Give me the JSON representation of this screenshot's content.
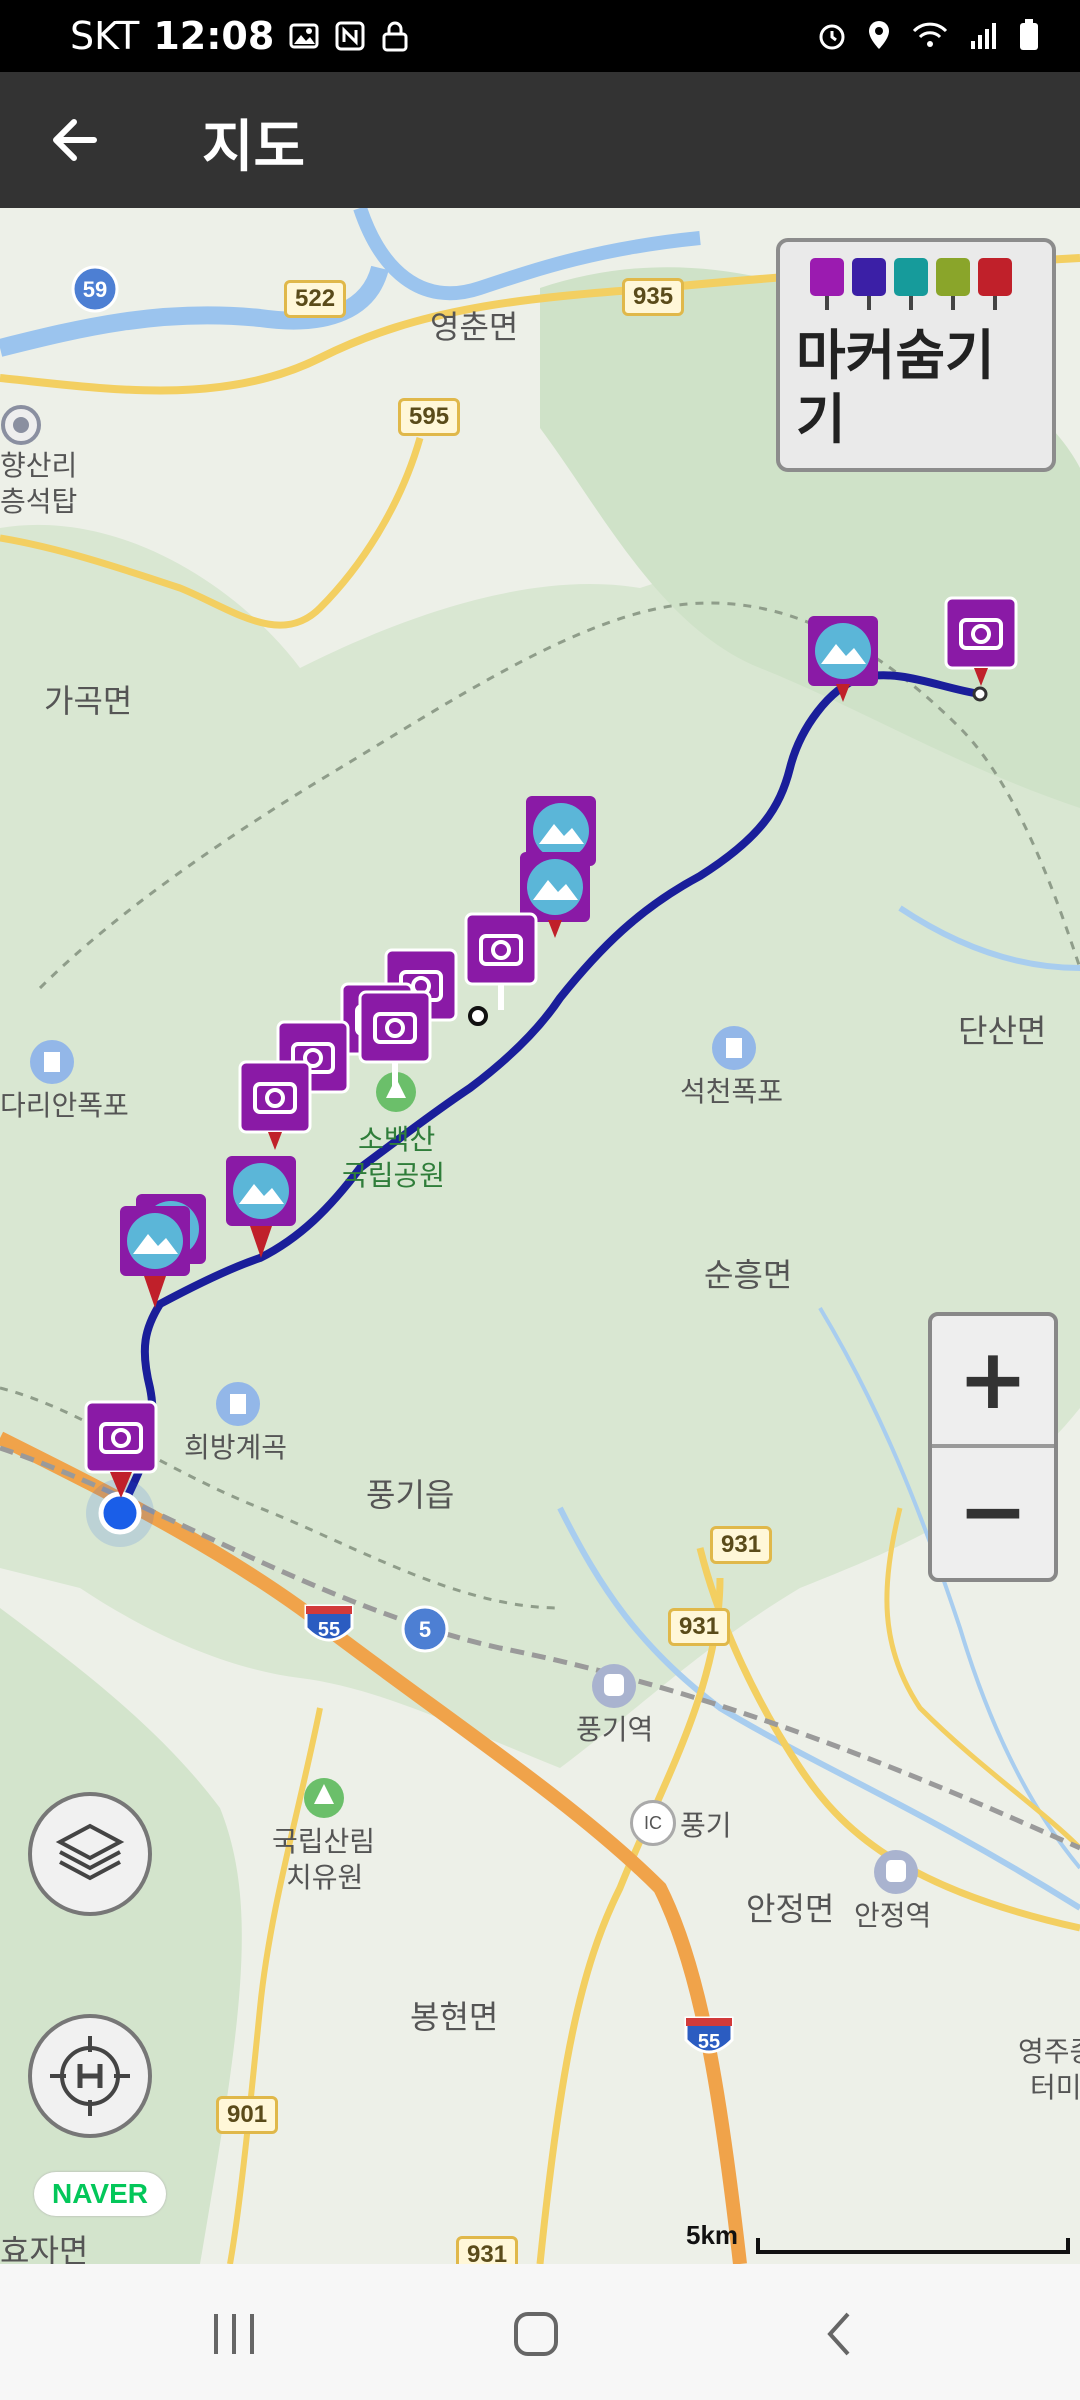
{
  "status_bar": {
    "carrier": "SKT",
    "time": "12:08"
  },
  "app_bar": {
    "title": "지도"
  },
  "marker_legend": {
    "hide_label": "마커숨기기",
    "marker_colors": [
      "#9b1bb0",
      "#3b1fa6",
      "#169b9b",
      "#8aa52a",
      "#c0202a"
    ]
  },
  "map": {
    "places": {
      "yeongchun": "영춘면",
      "gagok": "가곡면",
      "yeonghyang_line1": "향산리",
      "yeonghyang_line2": "층석탑",
      "dansan": "단산면",
      "seokcheon": "석천폭포",
      "sobaeksan_line1": "소백산",
      "sobaeksan_line2": "국립공원",
      "dari": "다리안폭포",
      "sunheung": "순흥면",
      "huibang": "희방계곡",
      "punggi_eup": "풍기읍",
      "punggi_station": "풍기역",
      "punggi_ic": "풍기",
      "ic": "IC",
      "forest_line1": "국립산림",
      "forest_line2": "치유원",
      "anjeong_myeon": "안정면",
      "anjeong_station": "안정역",
      "bonghyeon": "봉현면",
      "yeongju_line1": "영주종",
      "yeongju_line2": "터미",
      "hyoja": "효자면"
    },
    "roads": [
      "59",
      "522",
      "935",
      "595",
      "931",
      "931",
      "55",
      "5",
      "55",
      "901",
      "931"
    ],
    "scale_label": "5km",
    "provider": "NAVER"
  },
  "controls": {
    "zoom_in": "+",
    "zoom_out": "−"
  },
  "colors": {
    "route": "#1a1e9a",
    "marker": "#8a1aa6",
    "current_location": "#1a5ee8"
  }
}
